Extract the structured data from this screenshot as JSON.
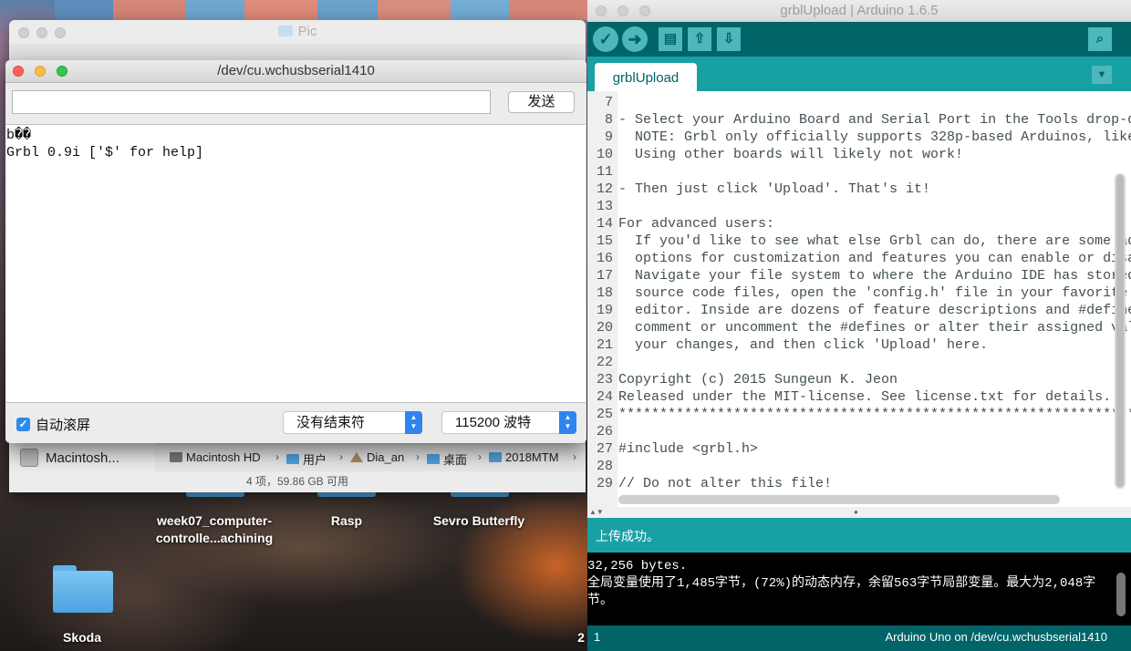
{
  "finder": {
    "title": "Pic",
    "path": [
      {
        "label": "Macintosh HD"
      },
      {
        "label": "用户"
      },
      {
        "label": "Dia_an"
      },
      {
        "label": "桌面"
      },
      {
        "label": "2018MTM"
      }
    ],
    "sidebar_disk": "Macintosh...",
    "status": "4 项，59.86 GB 可用"
  },
  "serial_monitor": {
    "title": "/dev/cu.wchusbserial1410",
    "input_value": "",
    "send_label": "发送",
    "output": [
      "b��",
      "Grbl 0.9i ['$' for help]"
    ],
    "autoscroll_label": "自动滚屏",
    "autoscroll_checked": true,
    "line_ending": "没有结束符",
    "baud_rate": "115200 波特"
  },
  "desktop": {
    "items": [
      {
        "label": "week07_computer-\ncontrolle...achining"
      },
      {
        "label": "Rasp"
      },
      {
        "label": "Sevro Butterfly"
      },
      {
        "label": "Skoda"
      }
    ],
    "edge_digit": "2"
  },
  "ide": {
    "title": "grblUpload | Arduino 1.6.5",
    "tab": "grblUpload",
    "code_lines": [
      {
        "n": "7",
        "text": ""
      },
      {
        "n": "8",
        "text": "- Select your Arduino Board and Serial Port in the Tools drop-down menu."
      },
      {
        "n": "9",
        "text": "  NOTE: Grbl only officially supports 328p-based Arduinos, like the Uno."
      },
      {
        "n": "10",
        "text": "  Using other boards will likely not work!"
      },
      {
        "n": "11",
        "text": ""
      },
      {
        "n": "12",
        "text": "- Then just click 'Upload'. That's it!"
      },
      {
        "n": "13",
        "text": ""
      },
      {
        "n": "14",
        "text": "For advanced users:"
      },
      {
        "n": "15",
        "text": "  If you'd like to see what else Grbl can do, there are some additional"
      },
      {
        "n": "16",
        "text": "  options for customization and features you can enable or disable."
      },
      {
        "n": "17",
        "text": "  Navigate your file system to where the Arduino IDE has stored the Grbl"
      },
      {
        "n": "18",
        "text": "  source code files, open the 'config.h' file in your favorite text"
      },
      {
        "n": "19",
        "text": "  editor. Inside are dozens of feature descriptions and #defines. Simply"
      },
      {
        "n": "20",
        "text": "  comment or uncomment the #defines or alter their assigned values, save"
      },
      {
        "n": "21",
        "text": "  your changes, and then click 'Upload' here."
      },
      {
        "n": "22",
        "text": ""
      },
      {
        "n": "23",
        "text": "Copyright (c) 2015 Sungeun K. Jeon"
      },
      {
        "n": "24",
        "text": "Released under the MIT-license. See license.txt for details."
      },
      {
        "n": "25",
        "text": "***********************************************************************************"
      },
      {
        "n": "26",
        "text": ""
      },
      {
        "n": "27",
        "text": "#include <grbl.h>"
      },
      {
        "n": "28",
        "text": ""
      },
      {
        "n": "29",
        "text": "// Do not alter this file!"
      }
    ],
    "status_message": "上传成功。",
    "console_lines": [
      "32,256 bytes.",
      "全局变量使用了1,485字节，(72%)的动态内存，余留563字节局部变量。最大为2,048字",
      "节。"
    ],
    "bottom_line": "1",
    "bottom_board": "Arduino Uno on /dev/cu.wchusbserial1410"
  }
}
